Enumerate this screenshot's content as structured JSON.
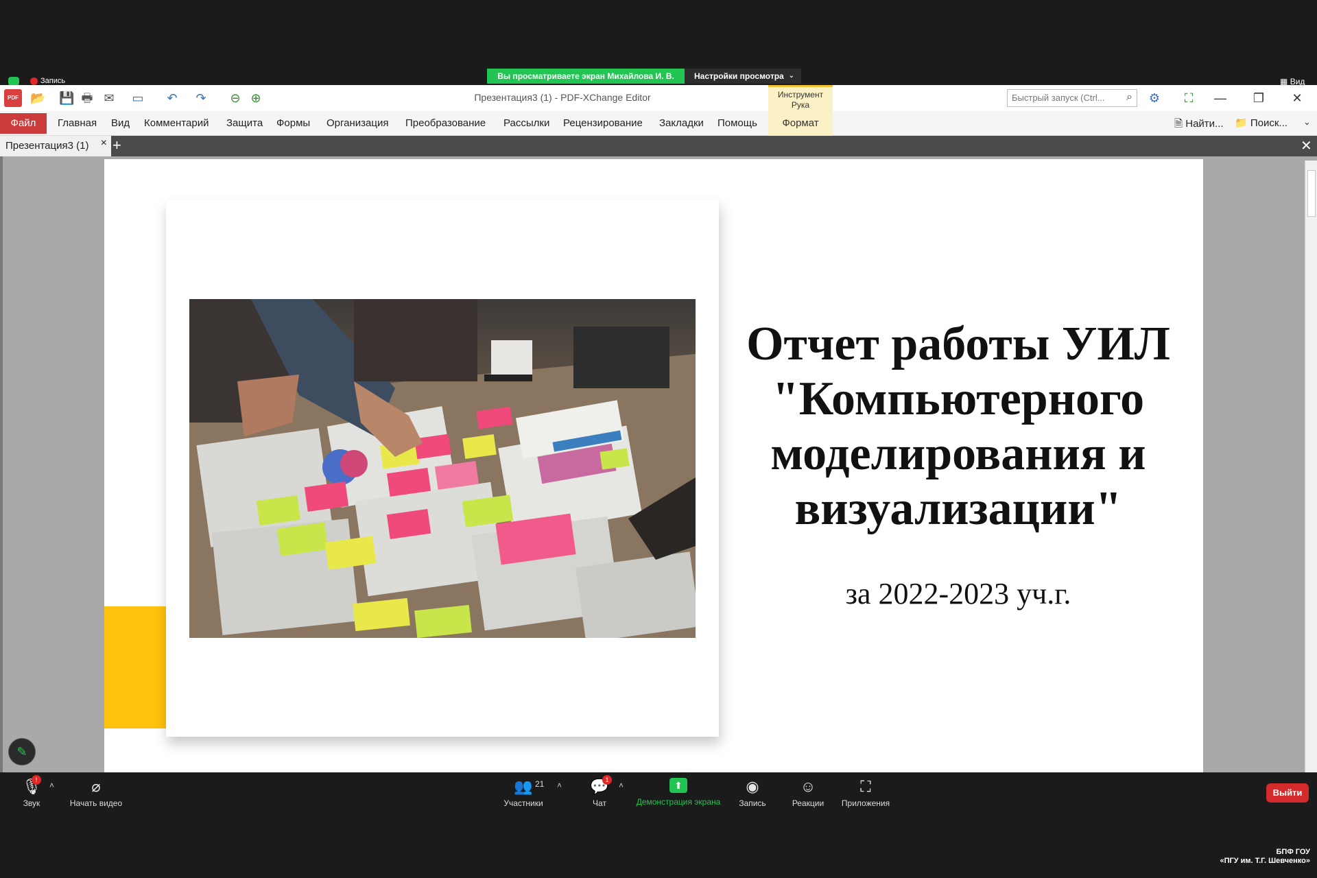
{
  "zoom": {
    "share_banner": "Вы просматриваете экран Михайлова И. В.",
    "view_settings": "Настройки просмотра",
    "recording_label": "Запись",
    "view_label": "Вид",
    "toolbar": {
      "audio": "Звук",
      "video": "Начать видео",
      "participants": "Участники",
      "participants_count": "21",
      "chat": "Чат",
      "chat_badge": "1",
      "audio_badge": "!",
      "share": "Демонстрация экрана",
      "record": "Запись",
      "reactions": "Реакции",
      "apps": "Приложения",
      "leave": "Выйти"
    },
    "watermark_line1": "БПФ ГОУ",
    "watermark_line2": "«ПГУ им. Т.Г. Шевченко»"
  },
  "app": {
    "window_title": "Презентация3 (1) - PDF-XChange Editor",
    "hand_tool_line1": "Инструмент",
    "hand_tool_line2": "Рука",
    "quick_launch_placeholder": "Быстрый запуск (Ctrl...",
    "menu": [
      "Файл",
      "Главная",
      "Вид",
      "Комментарий",
      "Защита",
      "Формы",
      "Организация",
      "Преобразование",
      "Рассылки",
      "Рецензирование",
      "Закладки",
      "Помощь"
    ],
    "format_tab": "Формат",
    "find": "Найти...",
    "search": "Поиск...",
    "doc_tab": "Презентация3 (1)"
  },
  "slide": {
    "title": "Отчет работы УИЛ \"Компьютерного моделирования и визуализации\"",
    "subtitle": "за 2022-2023 уч.г."
  },
  "colors": {
    "zoom_green": "#23c552",
    "file_menu_red": "#cc3b3b",
    "slide_accent_yellow": "#ffc20e",
    "leave_red": "#d32b2b"
  }
}
